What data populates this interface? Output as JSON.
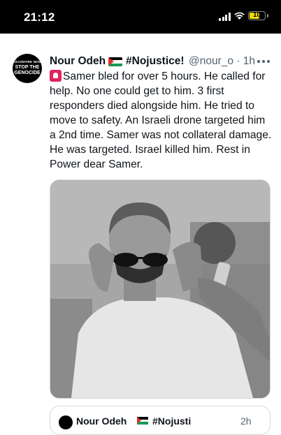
{
  "status_bar": {
    "time": "21:12",
    "battery_level": "10"
  },
  "tweet": {
    "author_name": "Nour Odeh",
    "author_flag": "palestine-flag",
    "author_tag": "#Nojustice!",
    "handle": "@nour_o",
    "separator": "·",
    "time_ago": "1h",
    "avatar_text_small": "CEASEFIRE NOW",
    "avatar_text_big_1": "STOP THE",
    "avatar_text_big_2": "GENOCIDE",
    "text": "Samer bled for over 5 hours. He called for help. No one could get to him. 3 first responders died alongside him. He tried to move to safety. An Israeli drone targeted him a 2nd time. Samer was not collateral damage. He was targeted. Israel killed him. Rest in Power dear Samer.",
    "text_icon": "siren-emoji",
    "image_kind": "photo"
  },
  "quoted_tweet": {
    "author_name": "Nour Odeh",
    "author_tag": "#Nojusti",
    "time_ago": "2h"
  },
  "colors": {
    "secondary_text": "#536471",
    "border": "#cfd9de",
    "accent_red": "#e0245e"
  }
}
